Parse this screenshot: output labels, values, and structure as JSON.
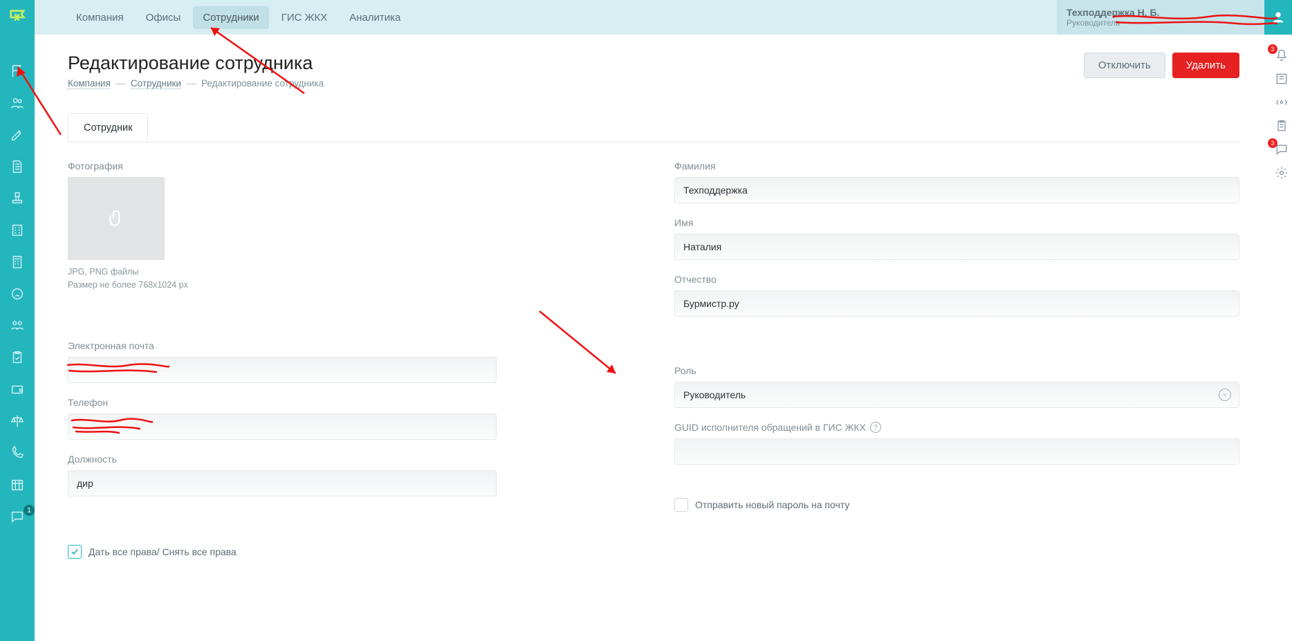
{
  "topnav": {
    "items": [
      "Компания",
      "Офисы",
      "Сотрудники",
      "ГИС ЖКХ",
      "Аналитика"
    ],
    "active_index": 2
  },
  "user": {
    "name": "Техподдержка Н. Б.",
    "role_prefix": "Руководитель"
  },
  "page": {
    "title": "Редактирование сотрудника",
    "crumbs": [
      "Компания",
      "Сотрудники",
      "Редактирование сотрудника"
    ]
  },
  "actions": {
    "disable": "Отключить",
    "delete": "Удалить"
  },
  "tabs": [
    "Сотрудник"
  ],
  "left_col": {
    "photo_label": "Фотография",
    "photo_hint1": "JPG, PNG файлы",
    "photo_hint2": "Размер не более 768х1024 px",
    "email_label": "Электронная почта",
    "email_value": "",
    "phone_label": "Телефон",
    "phone_value": "",
    "position_label": "Должность",
    "position_value": "дир",
    "rights_label": "Дать все права/ Снять все права"
  },
  "right_col": {
    "lastname_label": "Фамилия",
    "lastname_value": "Техподдержка",
    "firstname_label": "Имя",
    "firstname_value": "Наталия",
    "patronymic_label": "Отчество",
    "patronymic_value": "Бурмистр.ру",
    "role_label": "Роль",
    "role_value": "Руководитель",
    "guid_label": "GUID исполнителя обращений в ГИС ЖКХ",
    "guid_value": "",
    "sendpw_label": "Отправить новый пароль на почту"
  },
  "leftbar_badge": "1",
  "rightstrip_badges": {
    "bell": "3",
    "chat": "3"
  }
}
